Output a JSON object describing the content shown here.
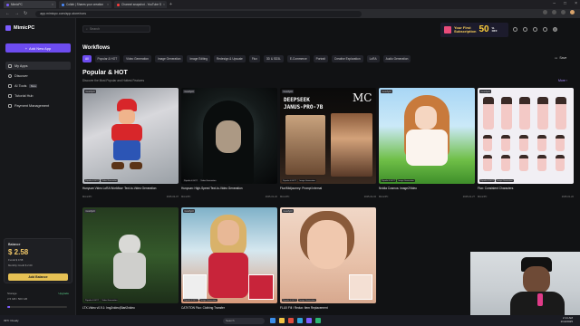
{
  "browser": {
    "tabs": [
      {
        "label": "MimicPC"
      },
      {
        "label": "Collab | Shares your creation"
      },
      {
        "label": "Channel snapshot - YouTube S"
      }
    ],
    "url": "app.mimicpc.com/app-store/runs"
  },
  "sidebar": {
    "logo": "MimicPC",
    "add_app": "Add New App",
    "nav": [
      {
        "label": "My Apps"
      },
      {
        "label": "Discover"
      },
      {
        "label": "AI Tools",
        "badge": "Beta"
      },
      {
        "label": "Tutorial Hub"
      },
      {
        "label": "Payment Management"
      }
    ],
    "balance": {
      "label": "Balance",
      "amount": "$ 2.58",
      "funds": "Funds $ 0.58",
      "bonus": "Monthly Credit $ 2.00",
      "add_label": "Add Balance"
    },
    "storage": {
      "label": "Storage",
      "value": "2.5 GB / 500 GB",
      "upgrade": "Upgrade",
      "fill": 0.05
    }
  },
  "header": {
    "search_placeholder": "Search",
    "promo": {
      "line1": "Your First",
      "line2": "Subscription",
      "big": "50",
      "pct": "%",
      "off": "OFF"
    }
  },
  "workflows": {
    "title": "Workflows",
    "chips": [
      "All",
      "Popular & HOT",
      "Video Generation",
      "Image Generation",
      "Image Editing",
      "Redesign & Upscale",
      "Flux",
      "3D & SD3L",
      "E-Commerce",
      "Portrait",
      "Creative Exploration",
      "LoRA",
      "Audio Generation"
    ],
    "save": "Save"
  },
  "section": {
    "title": "Popular & HOT",
    "subtitle": "Discover the Most Popular and Hottest Features",
    "more": "More"
  },
  "cards": [
    {
      "badge": "ComfyUI",
      "tags": [
        "Popular & HOT",
        "Video Generation"
      ],
      "title": "Hunyuan Video LoRA Workflow: Text-to-Video Generation",
      "author": "MimicPC",
      "date": "2025-02-07"
    },
    {
      "badge": "ComfyUI",
      "tags": [
        "Popular & HOT",
        "Video Generation"
      ],
      "title": "Hunyuan: High-Speed Text-to-Video Generation",
      "author": "MimicPC",
      "date": "2025-01-22"
    },
    {
      "badge": "ComfyUI",
      "tags": [
        "Popular & HOT",
        "Image Generation"
      ],
      "title": "Flux/Midjourney: Prompt Internal",
      "author": "MimicPC",
      "date": "2025-02-04",
      "overlay1": "DEEPSEEK",
      "overlay2": "JANUS-PRO-7B",
      "overlay3": "MC"
    },
    {
      "badge": "ComfyUI",
      "tags": [
        "Popular & HOT",
        "Image Generation"
      ],
      "title": "Nvidia Cosmos: Image2Video",
      "author": "MimicPC",
      "date": "2025-01-27"
    },
    {
      "badge": "ComfyUI",
      "tags": [
        "Popular & HOT",
        "Image Generation"
      ],
      "title": "Flux: Consistent Characters",
      "author": "MimicPC",
      "date": "2025-01-22"
    },
    {
      "badge": "ComfyUI",
      "tags": [
        "Popular & HOT",
        "Video Generation"
      ],
      "title": "LTX-Video v0.9.1: Img2video|Start2video",
      "author": "MimicPC",
      "date": "2025-01-06"
    },
    {
      "badge": "ComfyUI",
      "tags": [
        "Popular & HOT",
        "Image Generation"
      ],
      "title": "CATVTON Flux: Clothing Transfer",
      "author": "MimicPC",
      "date": "2024-12-23"
    },
    {
      "badge": "ComfyUI",
      "tags": [
        "Popular & HOT",
        "Image Generation"
      ],
      "title": "FLUX Fill / Redux: Item Replacement",
      "author": "MimicPC",
      "date": "2024-12-11"
    }
  ],
  "taskbar": {
    "weather": "39°F Cloudy",
    "search": "Search",
    "time": "2:14 AM",
    "date": "2/10/2025"
  }
}
